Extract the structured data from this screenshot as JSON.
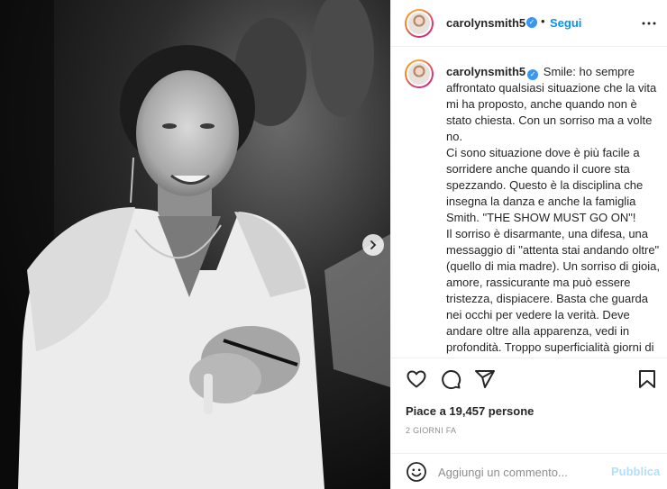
{
  "post": {
    "username": "carolynsmith5",
    "follow_separator": "•",
    "follow_label": "Segui",
    "verified_mark": "✓"
  },
  "caption": {
    "username": "carolynsmith5",
    "paragraphs": [
      "Smile: ho sempre affrontato qualsiasi situazione che la vita mi ha proposto, anche quando non è stato chiesta. Con un sorriso ma a volte no.",
      "Ci sono situazione dove è più facile a sorridere anche quando il cuore sta spezzando. Questo è la disciplina che insegna la danza e anche la famiglia Smith. \"THE SHOW MUST GO ON\"!",
      "Il sorriso è disarmante, una difesa, una messaggio di \"attenta stai andando oltre\"(quello di mia madre). Un sorriso di gioia, amore, rassicurante ma può essere tristezza, dispiacere. Basta che guarda nei occhi per vedere la verità. Deve andare oltre alla apparenza, vedi in profondità. Troppo superficialità giorni di oggi. Pochi guardano per vedere la realtà. Pochi ascoltano per"
    ]
  },
  "stats": {
    "likes": "Piace a 19,457 persone",
    "timestamp": "2 GIORNI FA"
  },
  "comment": {
    "placeholder": "Aggiungi un commento...",
    "publish_label": "Pubblica"
  },
  "icons": {
    "more": "more-icon",
    "like": "heart-icon",
    "comment": "comment-icon",
    "share": "share-icon",
    "save": "bookmark-icon",
    "emoji": "emoji-icon",
    "next": "chevron-right-icon"
  },
  "colors": {
    "accent": "#0095f6",
    "publish_disabled": "#b2dffc",
    "verified": "#3897f0",
    "muted": "#8e8e8e"
  }
}
